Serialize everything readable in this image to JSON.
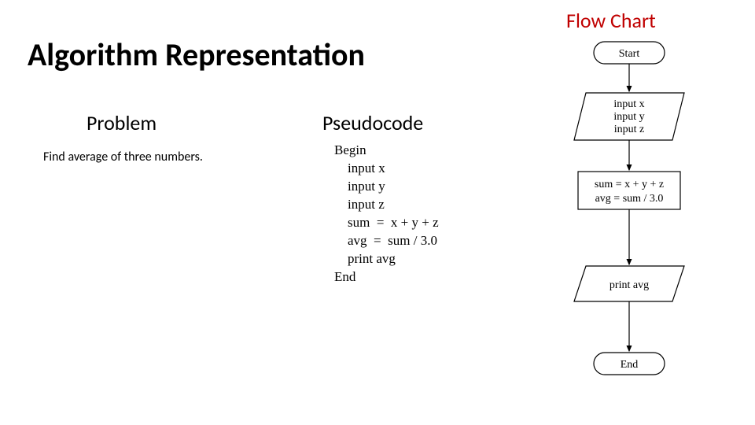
{
  "title": "Algorithm Representation",
  "flowchart_heading": "Flow Chart",
  "problem": {
    "heading": "Problem",
    "text": "Find average of three numbers."
  },
  "pseudocode": {
    "heading": "Pseudocode",
    "lines": {
      "l0": "Begin",
      "l1": "    input x",
      "l2": "    input y",
      "l3": "    input z",
      "l4": "    sum  =  x + y + z",
      "l5": "    avg  =  sum / 3.0",
      "l6": "    print avg",
      "l7": "End"
    }
  },
  "flowchart": {
    "start": "Start",
    "input_x": "input x",
    "input_y": "input y",
    "input_z": "input z",
    "sum": "sum = x + y + z",
    "avg": "avg = sum / 3.0",
    "print": "print avg",
    "end": "End"
  }
}
